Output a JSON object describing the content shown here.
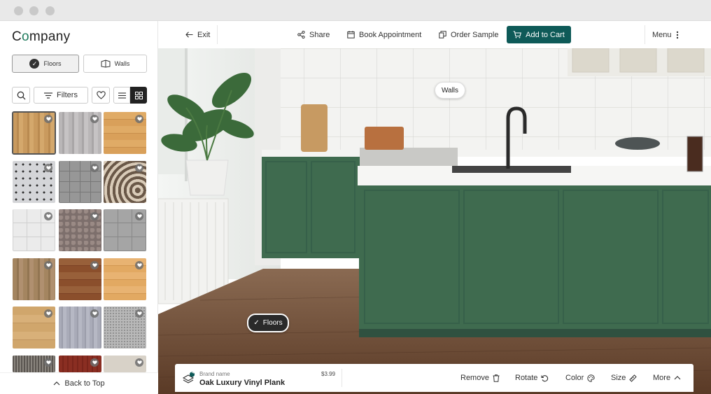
{
  "brand": {
    "logo_prefix": "C",
    "logo_o": "o",
    "logo_rest": "mpany"
  },
  "filters": {
    "floors_label": "Floors",
    "walls_label": "Walls",
    "filters_label": "Filters"
  },
  "back_to_top": "Back to Top",
  "topbar": {
    "exit": "Exit",
    "share": "Share",
    "book": "Book Appointment",
    "order": "Order Sample",
    "cart": "Add to Cart",
    "menu": "Menu"
  },
  "scene": {
    "walls_tag": "Walls",
    "floors_tag": "Floors"
  },
  "product": {
    "brand": "Brand name",
    "name": "Oak Luxury Vinyl Plank",
    "price": "$3.99",
    "badge": "4",
    "remove": "Remove",
    "rotate": "Rotate",
    "color": "Color",
    "size": "Size",
    "more": "More"
  },
  "colors": {
    "accent": "#0e5a58",
    "cabinet": "#3f6b4f",
    "floor": "#6b4a33"
  },
  "swatches": [
    {
      "name": "light-oak",
      "selected": true
    },
    {
      "name": "grey-wood"
    },
    {
      "name": "honey-plank"
    },
    {
      "name": "dot-tile"
    },
    {
      "name": "grey-stone-tile"
    },
    {
      "name": "swirl-pattern"
    },
    {
      "name": "white-tile"
    },
    {
      "name": "pebble-stone"
    },
    {
      "name": "grey-square-tile"
    },
    {
      "name": "driftwood"
    },
    {
      "name": "walnut"
    },
    {
      "name": "maple"
    },
    {
      "name": "natural-oak"
    },
    {
      "name": "silver-grain"
    },
    {
      "name": "speckled-granite"
    },
    {
      "name": "dark-texture"
    },
    {
      "name": "cherry"
    },
    {
      "name": "cream-stone"
    }
  ]
}
